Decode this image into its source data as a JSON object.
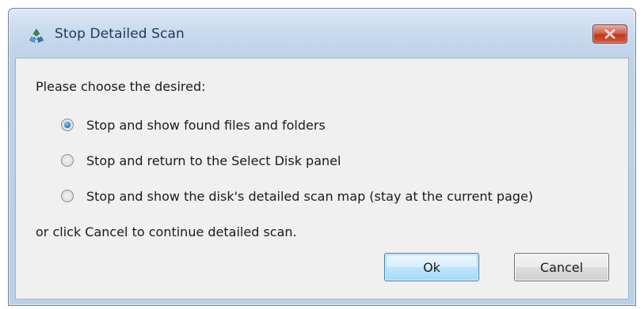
{
  "window": {
    "title": "Stop Detailed Scan",
    "app_icon": "recycle-icon",
    "close_icon": "close-icon"
  },
  "dialog": {
    "prompt": "Please choose the desired:",
    "options": [
      {
        "label": "Stop and show found files and folders",
        "checked": true
      },
      {
        "label": "Stop and return to the Select Disk panel",
        "checked": false
      },
      {
        "label": "Stop and show the disk's detailed scan map (stay at the current page)",
        "checked": false
      }
    ],
    "cancel_note": "or click Cancel to continue detailed scan."
  },
  "buttons": {
    "ok_label": "Ok",
    "cancel_label": "Cancel"
  },
  "colors": {
    "title_text": "#1e395b",
    "close_button": "#c7432a",
    "radio_dot": "#2d8ad6",
    "ok_button_highlight": "#bee6fd",
    "client_background": "#f0f0f0"
  }
}
